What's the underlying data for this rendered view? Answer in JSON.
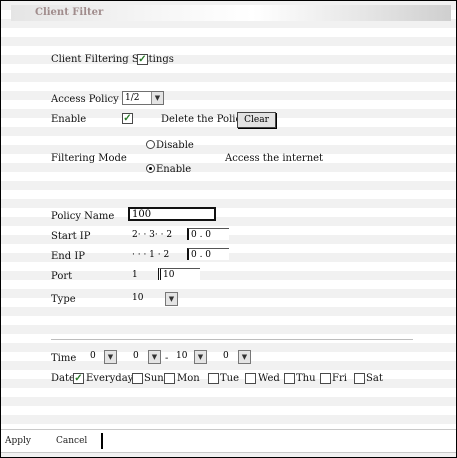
{
  "header": {
    "title": "Client Filter"
  },
  "filtering_settings": {
    "label": "Client Filtering Settings",
    "checked": true,
    "mark": "✓"
  },
  "access_policy": {
    "label": "Access Policy",
    "value": "1/2"
  },
  "enable_row": {
    "label": "Enable",
    "mark": "✓",
    "delete_label": "Delete the Policy",
    "clear_button": "Clear"
  },
  "filtering_mode": {
    "label": "Filtering Mode",
    "options": [
      {
        "label": "Disable",
        "selected": false
      },
      {
        "label": "Enable",
        "selected": true
      }
    ],
    "note": "Access the internet"
  },
  "policy": {
    "name_label": "Policy Name",
    "name_value": "100",
    "start_ip_label": "Start IP",
    "start_ip_a": "2· · 3· · 2",
    "start_ip_b": "0 . 0",
    "end_ip_label": "End IP",
    "end_ip_a": "· · · 1 · 2",
    "end_ip_b": "0 . 0",
    "port_label": "Port",
    "port_a": "1",
    "port_b": "10",
    "type_label": "Type",
    "type_value": "10"
  },
  "time": {
    "label": "Time",
    "start_hour": "0",
    "start_min": "0",
    "sep": "-",
    "end_hour": "10",
    "end_min": "0"
  },
  "date": {
    "label": "Date",
    "days": [
      {
        "label": "Everyday",
        "checked": true
      },
      {
        "label": "Sun",
        "checked": false
      },
      {
        "label": "Mon",
        "checked": false
      },
      {
        "label": "Tue",
        "checked": false
      },
      {
        "label": "Wed",
        "checked": false
      },
      {
        "label": "Thu",
        "checked": false
      },
      {
        "label": "Fri",
        "checked": false
      },
      {
        "label": "Sat",
        "checked": false
      }
    ]
  },
  "footer": {
    "apply": "Apply",
    "cancel": "Cancel"
  },
  "icons": {
    "dropdown": "chevron-down-icon",
    "check": "checkmark-icon"
  }
}
